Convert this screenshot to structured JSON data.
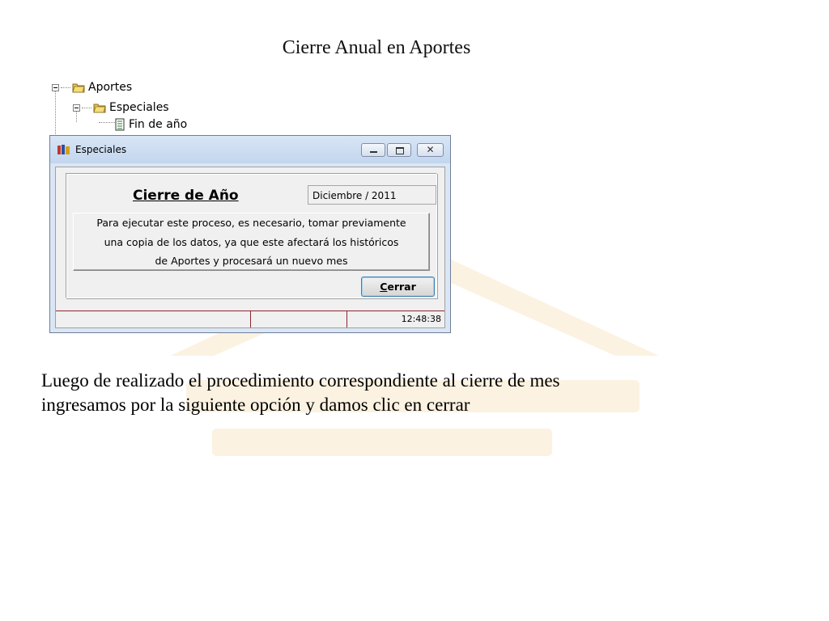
{
  "slide": {
    "title": "Cierre Anual en Aportes",
    "caption_line1": "Luego de realizado el procedimiento correspondiente al cierre de mes",
    "caption_line2": "ingresamos por la siguiente opción y damos clic en cerrar"
  },
  "tree": {
    "items": [
      {
        "label": "Aportes",
        "icon": "folder-icon"
      },
      {
        "label": "Especiales",
        "icon": "folder-icon"
      },
      {
        "label": "Fin de año",
        "icon": "document-icon"
      }
    ]
  },
  "window": {
    "title": "Especiales",
    "heading": "Cierre de Año",
    "period_value": "Diciembre / 2011",
    "message_lines": [
      "Para ejecutar este proceso, es necesario, tomar previamente",
      "una copia de los datos, ya que este  afectará los históricos",
      "de Aportes y procesará un nuevo mes"
    ],
    "close_button_accel": "C",
    "close_button_rest": "errar",
    "status_time": "12:48:38",
    "close_glyph": "✕"
  },
  "colors": {
    "status_border": "#8c2630",
    "titlebar": "#c3d6ee",
    "watermark": "#f5d7a8"
  }
}
